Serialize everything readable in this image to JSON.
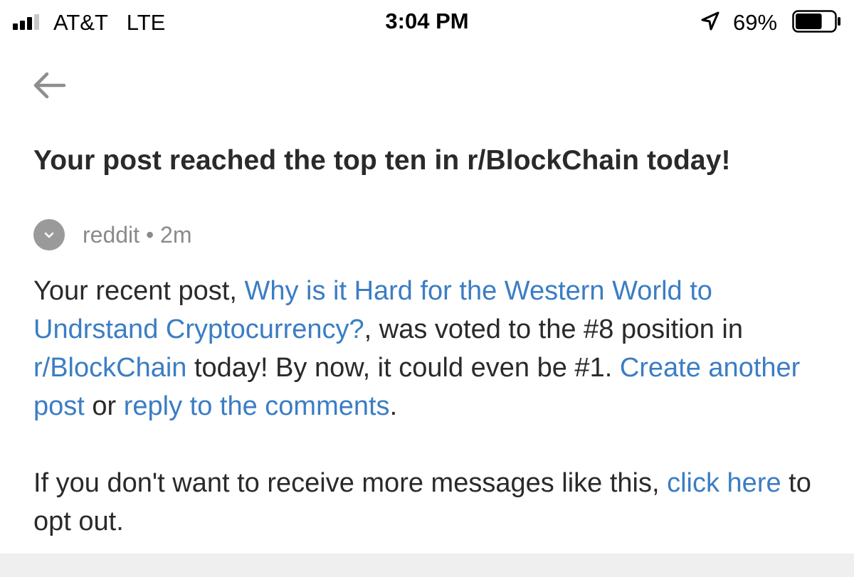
{
  "status_bar": {
    "carrier": "AT&T",
    "network": "LTE",
    "time": "3:04 PM",
    "battery_percent": "69%",
    "battery_level": 0.69,
    "icons": [
      "signal-bars-icon",
      "location-arrow-icon",
      "battery-icon"
    ]
  },
  "header": {
    "back_icon": "back-arrow-icon"
  },
  "notification": {
    "title": "Your post reached the top ten in r/BlockChain today!",
    "sender": "reddit",
    "separator": "•",
    "age": "2m",
    "body": {
      "text_1": "Your recent post, ",
      "post_link": "Why is it Hard for the Western World to Undrstand Cryptocurrency?",
      "text_2": ", was voted to the #8 position in ",
      "subreddit_link": "r/BlockChain",
      "text_3": " today! By now, it could even be #1. ",
      "create_post_link": "Create another post",
      "text_4": " or ",
      "reply_link": "reply to the comments",
      "text_5": "."
    },
    "opt_out": {
      "text_1": "If you don't want to receive more messages like this, ",
      "link": "click here",
      "text_2": " to opt out."
    }
  },
  "colors": {
    "link": "#3b7dc4",
    "text": "#2a2a2a",
    "muted": "#8a8a8a",
    "avatar": "#9a9a9a",
    "footer_bg": "#efefef"
  }
}
